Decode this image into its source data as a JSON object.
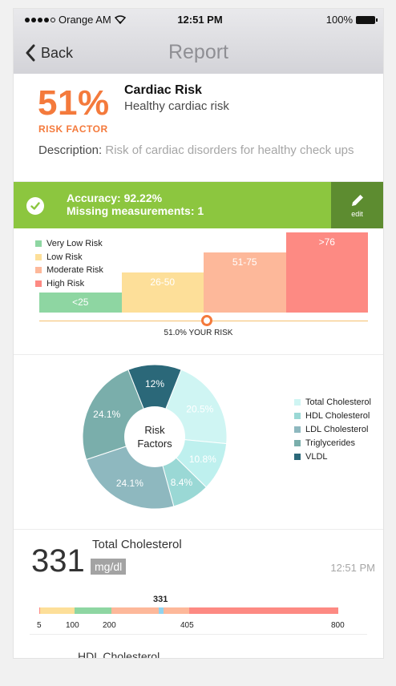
{
  "status": {
    "carrier": "Orange AM",
    "time": "12:51 PM",
    "battery": "100%"
  },
  "nav": {
    "back": "Back",
    "title": "Report"
  },
  "risk": {
    "percent": "51%",
    "factor_label": "RISK FACTOR",
    "title": "Cardiac Risk",
    "subtitle": "Healthy cardiac risk",
    "desc_key": "Description:",
    "desc_value": "Risk of cardiac disorders for healthy check ups"
  },
  "accuracy": {
    "line1": "Accuracy: 92.22%",
    "line2": "Missing measurements: 1",
    "edit_label": "edit"
  },
  "risk_chart": {
    "legend": [
      {
        "label": "Very Low Risk",
        "color": "#8ed6a2"
      },
      {
        "label": "Low Risk",
        "color": "#fddf99"
      },
      {
        "label": "Moderate Risk",
        "color": "#fdb89a"
      },
      {
        "label": "High Risk",
        "color": "#fd8a83"
      }
    ],
    "bands": [
      {
        "label": "<25",
        "level": 1
      },
      {
        "label": "26-50",
        "level": 2
      },
      {
        "label": "51-75",
        "level": 3
      },
      {
        "label": ">76",
        "level": 4
      }
    ],
    "your_risk_value": 51.0,
    "your_risk_text": "51.0% YOUR RISK"
  },
  "pie": {
    "center_line1": "Risk",
    "center_line2": "Factors",
    "legend": [
      {
        "label": "Total Cholesterol",
        "color": "#cff5f3"
      },
      {
        "label": "HDL Cholesterol",
        "color": "#9ad8d5"
      },
      {
        "label": "LDL Cholesterol",
        "color": "#8eb8bf"
      },
      {
        "label": "Triglycerides",
        "color": "#7aaeab"
      },
      {
        "label": "VLDL",
        "color": "#2b6879"
      }
    ]
  },
  "chart_data": {
    "type": "pie",
    "title": "",
    "slices": [
      {
        "label": "VLDL",
        "value": 12.0,
        "text": "12%",
        "color": "#2b6879"
      },
      {
        "label": "Total Cholesterol",
        "value": 20.5,
        "text": "20.5%",
        "color": "#cff5f3"
      },
      {
        "label": "HDL Cholesterol",
        "value": 10.8,
        "text": "10.8%",
        "color": "#bef0ee"
      },
      {
        "label": "HDL Cholesterol",
        "value": 8.4,
        "text": "8.4%",
        "color": "#9ad8d5"
      },
      {
        "label": "LDL Cholesterol",
        "value": 24.1,
        "text": "24.1%",
        "color": "#8eb8bf"
      },
      {
        "label": "Triglycerides",
        "value": 24.1,
        "text": "24.1%",
        "color": "#7aaeab"
      }
    ]
  },
  "metric": {
    "value": "331",
    "name": "Total Cholesterol",
    "unit": "mg/dl",
    "time": "12:51 PM",
    "scale_value_label": "331",
    "scale_value": 331,
    "scale_min": 0,
    "scale_max": 800,
    "segments": [
      {
        "from": 0,
        "to": 5,
        "color": "#fd8a83"
      },
      {
        "from": 5,
        "to": 100,
        "color": "#fddf99"
      },
      {
        "from": 100,
        "to": 200,
        "color": "#8ed6a2"
      },
      {
        "from": 200,
        "to": 405,
        "color": "#fdb89a"
      },
      {
        "from": 405,
        "to": 800,
        "color": "#fd8a83"
      }
    ],
    "ticks": [
      "5",
      "100",
      "200",
      "405",
      "800"
    ]
  },
  "next_metric": {
    "name": "HDL Cholesterol"
  }
}
